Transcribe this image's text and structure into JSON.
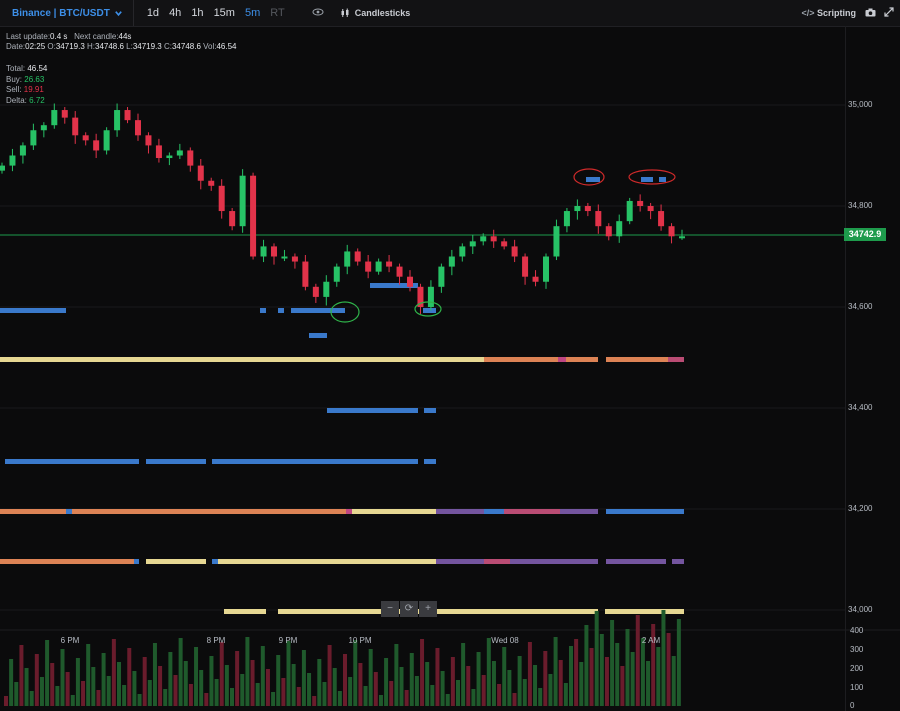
{
  "topbar": {
    "exchange": "Binance | BTC/USDT",
    "timeframes": [
      {
        "label": "1d",
        "state": "normal"
      },
      {
        "label": "4h",
        "state": "normal"
      },
      {
        "label": "1h",
        "state": "normal"
      },
      {
        "label": "15m",
        "state": "normal"
      },
      {
        "label": "5m",
        "state": "active"
      },
      {
        "label": "RT",
        "state": "dim"
      }
    ],
    "chart_type": "Candlesticks",
    "scripting": "Scripting"
  },
  "info": {
    "last_update_label": "Last update:",
    "last_update": "0.4 s",
    "next_candle_label": "Next candle:",
    "next_candle": "44s",
    "date_label": "Date:",
    "date": "02:25",
    "o_label": "O:",
    "o": "34719.3",
    "h_label": "H:",
    "h": "34748.6",
    "l_label": "L:",
    "l": "34719.3",
    "c_label": "C:",
    "c": "34748.6",
    "vol_label": "Vol:",
    "vol": "46.54"
  },
  "stats": {
    "total_label": "Total:",
    "total": "46.54",
    "buy_label": "Buy:",
    "buy": "26.63",
    "sell_label": "Sell:",
    "sell": "19.91",
    "delta_label": "Delta:",
    "delta": "6.72"
  },
  "price_axis": [
    "35,000",
    "34,800",
    "34,600",
    "34,400",
    "34,200",
    "34,000"
  ],
  "current_price": "34742.9",
  "time_axis": [
    "6 PM",
    "8 PM",
    "9 PM",
    "10 PM",
    "Wed 08",
    "2 AM"
  ],
  "volume_axis": [
    "400",
    "300",
    "200",
    "100",
    "0"
  ],
  "controls": [
    "−",
    "⟳",
    "+"
  ],
  "colors": {
    "up": "#27c266",
    "down": "#e2334a",
    "accent": "#3d8fe8",
    "price_line": "#1e9b4c",
    "wall_blue": "#3d7fd6",
    "wall_yellow": "#f2e39a",
    "wall_orange": "#e98a5a",
    "wall_pink": "#c94a8a",
    "wall_purple": "#7a5aa8"
  }
}
